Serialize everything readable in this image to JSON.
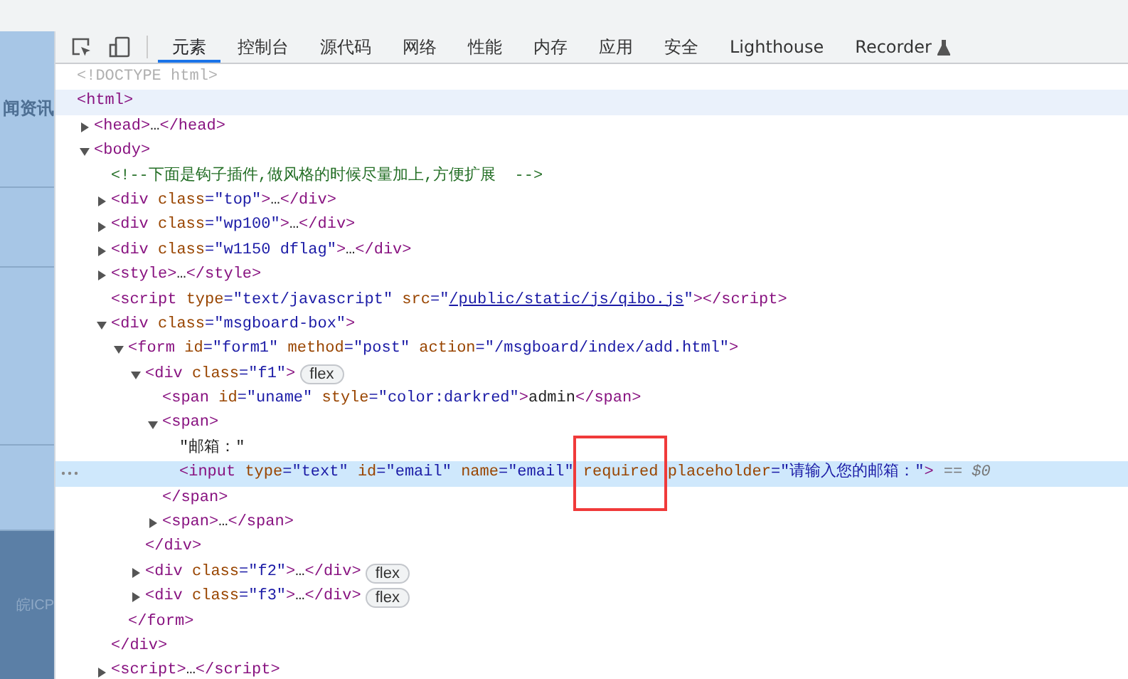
{
  "page_behind": {
    "heading": "闻资讯",
    "footer": "皖ICP"
  },
  "devtools": {
    "tabs": [
      {
        "label": "元素",
        "selected": true
      },
      {
        "label": "控制台",
        "selected": false
      },
      {
        "label": "源代码",
        "selected": false
      },
      {
        "label": "网络",
        "selected": false
      },
      {
        "label": "性能",
        "selected": false
      },
      {
        "label": "内存",
        "selected": false
      },
      {
        "label": "应用",
        "selected": false
      },
      {
        "label": "安全",
        "selected": false
      },
      {
        "label": "Lighthouse",
        "selected": false
      },
      {
        "label": "Recorder",
        "selected": false,
        "experimental": true
      }
    ],
    "dom_tree": [
      {
        "selected": false,
        "hovered": false,
        "parts": [
          {
            "kind": "doctype",
            "text": "<!DOCTYPE html>"
          }
        ]
      },
      {
        "selected": false,
        "hovered": true,
        "parts": [
          {
            "kind": "tag",
            "text": "<html>"
          }
        ],
        "children": [
          {
            "expanded": false,
            "selected": false,
            "hovered": false,
            "parts": [
              {
                "kind": "tag",
                "text": "<head>"
              },
              {
                "kind": "text",
                "text": "…"
              },
              {
                "kind": "tag",
                "text": "</head>"
              }
            ]
          },
          {
            "expanded": true,
            "selected": false,
            "hovered": false,
            "parts": [
              {
                "kind": "tag",
                "text": "<body>"
              }
            ],
            "children": [
              {
                "selected": false,
                "hovered": false,
                "parts": [
                  {
                    "kind": "comment",
                    "text": "<!--下面是钩子插件,做风格的时候尽量加上,方便扩展  -->"
                  }
                ]
              },
              {
                "expanded": false,
                "selected": false,
                "hovered": false,
                "parts": [
                  {
                    "kind": "tag",
                    "text": "<div"
                  },
                  {
                    "kind": "attr",
                    "text": " class"
                  },
                  {
                    "kind": "value",
                    "text": "=\"top\""
                  },
                  {
                    "kind": "tag",
                    "text": ">"
                  },
                  {
                    "kind": "text",
                    "text": "…"
                  },
                  {
                    "kind": "tag",
                    "text": "</div>"
                  }
                ]
              },
              {
                "expanded": false,
                "selected": false,
                "hovered": false,
                "parts": [
                  {
                    "kind": "tag",
                    "text": "<div"
                  },
                  {
                    "kind": "attr",
                    "text": " class"
                  },
                  {
                    "kind": "value",
                    "text": "=\"wp100\""
                  },
                  {
                    "kind": "tag",
                    "text": ">"
                  },
                  {
                    "kind": "text",
                    "text": "…"
                  },
                  {
                    "kind": "tag",
                    "text": "</div>"
                  }
                ]
              },
              {
                "expanded": false,
                "selected": false,
                "hovered": false,
                "parts": [
                  {
                    "kind": "tag",
                    "text": "<div"
                  },
                  {
                    "kind": "attr",
                    "text": " class"
                  },
                  {
                    "kind": "value",
                    "text": "=\"w1150 dflag\""
                  },
                  {
                    "kind": "tag",
                    "text": ">"
                  },
                  {
                    "kind": "text",
                    "text": "…"
                  },
                  {
                    "kind": "tag",
                    "text": "</div>"
                  }
                ]
              },
              {
                "expanded": false,
                "selected": false,
                "hovered": false,
                "parts": [
                  {
                    "kind": "tag",
                    "text": "<style>"
                  },
                  {
                    "kind": "text",
                    "text": "…"
                  },
                  {
                    "kind": "tag",
                    "text": "</style>"
                  }
                ]
              },
              {
                "selected": false,
                "hovered": false,
                "parts": [
                  {
                    "kind": "tag",
                    "text": "<script"
                  },
                  {
                    "kind": "attr",
                    "text": " type"
                  },
                  {
                    "kind": "value",
                    "text": "=\"text/javascript\""
                  },
                  {
                    "kind": "attr",
                    "text": " src"
                  },
                  {
                    "kind": "value",
                    "text": "=\""
                  },
                  {
                    "kind": "link",
                    "text": "/public/static/js/qibo.js"
                  },
                  {
                    "kind": "value",
                    "text": "\""
                  },
                  {
                    "kind": "tag",
                    "text": "></script>"
                  }
                ]
              },
              {
                "expanded": true,
                "selected": false,
                "hovered": false,
                "parts": [
                  {
                    "kind": "tag",
                    "text": "<div"
                  },
                  {
                    "kind": "attr",
                    "text": " class"
                  },
                  {
                    "kind": "value",
                    "text": "=\"msgboard-box\""
                  },
                  {
                    "kind": "tag",
                    "text": ">"
                  }
                ],
                "children": [
                  {
                    "expanded": true,
                    "selected": false,
                    "hovered": false,
                    "parts": [
                      {
                        "kind": "tag",
                        "text": "<form"
                      },
                      {
                        "kind": "attr",
                        "text": " id"
                      },
                      {
                        "kind": "value",
                        "text": "=\"form1\""
                      },
                      {
                        "kind": "attr",
                        "text": " method"
                      },
                      {
                        "kind": "value",
                        "text": "=\"post\""
                      },
                      {
                        "kind": "attr",
                        "text": " action"
                      },
                      {
                        "kind": "value",
                        "text": "=\"/msgboard/index/add.html\""
                      },
                      {
                        "kind": "tag",
                        "text": ">"
                      }
                    ],
                    "children": [
                      {
                        "expanded": true,
                        "selected": false,
                        "hovered": false,
                        "badge": "flex",
                        "parts": [
                          {
                            "kind": "tag",
                            "text": "<div"
                          },
                          {
                            "kind": "attr",
                            "text": " class"
                          },
                          {
                            "kind": "value",
                            "text": "=\"f1\""
                          },
                          {
                            "kind": "tag",
                            "text": ">"
                          }
                        ],
                        "children": [
                          {
                            "selected": false,
                            "hovered": false,
                            "parts": [
                              {
                                "kind": "tag",
                                "text": "<span"
                              },
                              {
                                "kind": "attr",
                                "text": " id"
                              },
                              {
                                "kind": "value",
                                "text": "=\"uname\""
                              },
                              {
                                "kind": "attr",
                                "text": " style"
                              },
                              {
                                "kind": "value",
                                "text": "=\"color:darkred\""
                              },
                              {
                                "kind": "tag",
                                "text": ">"
                              },
                              {
                                "kind": "text",
                                "text": "admin"
                              },
                              {
                                "kind": "tag",
                                "text": "</span>"
                              }
                            ]
                          },
                          {
                            "expanded": true,
                            "selected": false,
                            "hovered": false,
                            "parts": [
                              {
                                "kind": "tag",
                                "text": "<span>"
                              }
                            ],
                            "children": [
                              {
                                "selected": false,
                                "hovered": false,
                                "parts": [
                                  {
                                    "kind": "text",
                                    "text": "\"邮箱：\""
                                  }
                                ]
                              },
                              {
                                "selected": true,
                                "hovered": false,
                                "suffix": "== $0",
                                "parts": [
                                  {
                                    "kind": "tag",
                                    "text": "<input"
                                  },
                                  {
                                    "kind": "attr",
                                    "text": " type"
                                  },
                                  {
                                    "kind": "value",
                                    "text": "=\"text\""
                                  },
                                  {
                                    "kind": "attr",
                                    "text": " id"
                                  },
                                  {
                                    "kind": "value",
                                    "text": "=\"email\""
                                  },
                                  {
                                    "kind": "attr",
                                    "text": " name"
                                  },
                                  {
                                    "kind": "value",
                                    "text": "=\"email\""
                                  },
                                  {
                                    "kind": "attr-boxed",
                                    "text": " required"
                                  },
                                  {
                                    "kind": "attr",
                                    "text": " placeholder"
                                  },
                                  {
                                    "kind": "value",
                                    "text": "=\"请输入您的邮箱：\""
                                  },
                                  {
                                    "kind": "tag",
                                    "text": ">"
                                  }
                                ]
                              }
                            ]
                          },
                          {
                            "selected": false,
                            "hovered": false,
                            "parts": [
                              {
                                "kind": "tag",
                                "text": "</span>"
                              }
                            ]
                          },
                          {
                            "expanded": false,
                            "selected": false,
                            "hovered": false,
                            "parts": [
                              {
                                "kind": "tag",
                                "text": "<span>"
                              },
                              {
                                "kind": "text",
                                "text": "…"
                              },
                              {
                                "kind": "tag",
                                "text": "</span>"
                              }
                            ]
                          }
                        ]
                      },
                      {
                        "selected": false,
                        "hovered": false,
                        "parts": [
                          {
                            "kind": "tag",
                            "text": "</div>"
                          }
                        ]
                      },
                      {
                        "expanded": false,
                        "selected": false,
                        "hovered": false,
                        "badge": "flex",
                        "parts": [
                          {
                            "kind": "tag",
                            "text": "<div"
                          },
                          {
                            "kind": "attr",
                            "text": " class"
                          },
                          {
                            "kind": "value",
                            "text": "=\"f2\""
                          },
                          {
                            "kind": "tag",
                            "text": ">"
                          },
                          {
                            "kind": "text",
                            "text": "…"
                          },
                          {
                            "kind": "tag",
                            "text": "</div>"
                          }
                        ]
                      },
                      {
                        "expanded": false,
                        "selected": false,
                        "hovered": false,
                        "badge": "flex",
                        "parts": [
                          {
                            "kind": "tag",
                            "text": "<div"
                          },
                          {
                            "kind": "attr",
                            "text": " class"
                          },
                          {
                            "kind": "value",
                            "text": "=\"f3\""
                          },
                          {
                            "kind": "tag",
                            "text": ">"
                          },
                          {
                            "kind": "text",
                            "text": "…"
                          },
                          {
                            "kind": "tag",
                            "text": "</div>"
                          }
                        ]
                      }
                    ]
                  },
                  {
                    "selected": false,
                    "hovered": false,
                    "parts": [
                      {
                        "kind": "tag",
                        "text": "</form>"
                      }
                    ]
                  }
                ]
              },
              {
                "selected": false,
                "hovered": false,
                "parts": [
                  {
                    "kind": "tag",
                    "text": "</div>"
                  }
                ]
              },
              {
                "expanded": false,
                "selected": false,
                "hovered": false,
                "parts": [
                  {
                    "kind": "tag",
                    "text": "<script>"
                  },
                  {
                    "kind": "text",
                    "text": "…"
                  },
                  {
                    "kind": "tag",
                    "text": "</script>"
                  }
                ]
              }
            ]
          }
        ]
      }
    ]
  }
}
